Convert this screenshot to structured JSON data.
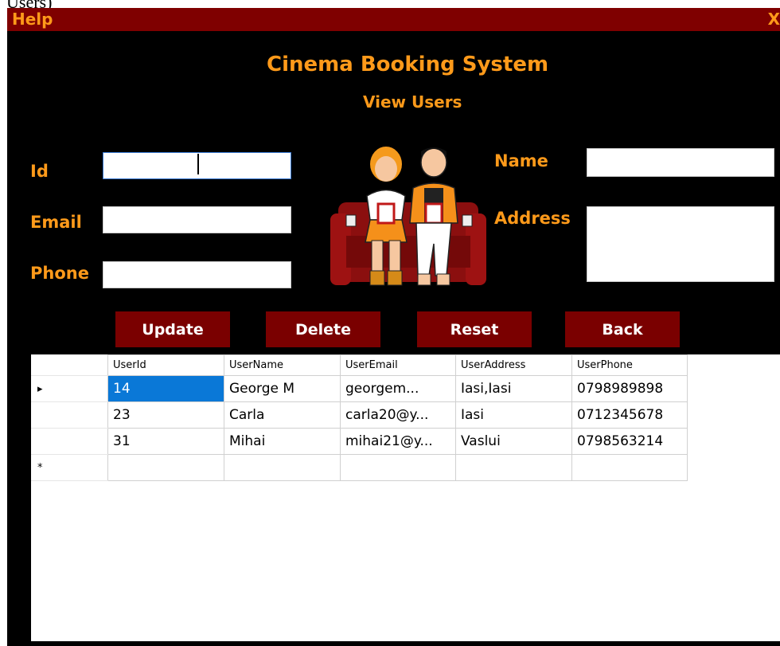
{
  "caption": "Users)",
  "window": {
    "menu_help": "Help",
    "close_label": "X"
  },
  "header": {
    "title": "Cinema Booking System",
    "subtitle": "View Users"
  },
  "form": {
    "id_label": "Id",
    "id_value": "",
    "email_label": "Email",
    "email_value": "",
    "phone_label": "Phone",
    "phone_value": "",
    "name_label": "Name",
    "name_value": "",
    "address_label": "Address",
    "address_value": ""
  },
  "buttons": {
    "update": "Update",
    "delete": "Delete",
    "reset": "Reset",
    "back": "Back"
  },
  "table": {
    "columns": [
      "UserId",
      "UserName",
      "UserEmail",
      "UserAddress",
      "UserPhone"
    ],
    "current_row_marker": "▸",
    "new_row_marker": "*",
    "rows": [
      [
        "14",
        "George M",
        "georgem...",
        "Iasi,Iasi",
        "0798989898"
      ],
      [
        "23",
        "Carla",
        "carla20@y...",
        "Iasi",
        "0712345678"
      ],
      [
        "31",
        "Mihai",
        "mihai21@y...",
        "Vaslui",
        "0798563214"
      ]
    ]
  },
  "colors": {
    "accent": "#ff9a1a",
    "titlebar": "#7f0000",
    "button": "#7a0000",
    "selection": "#0a78d7"
  },
  "icons": {
    "illustration": "cinema-couple-illustration"
  }
}
